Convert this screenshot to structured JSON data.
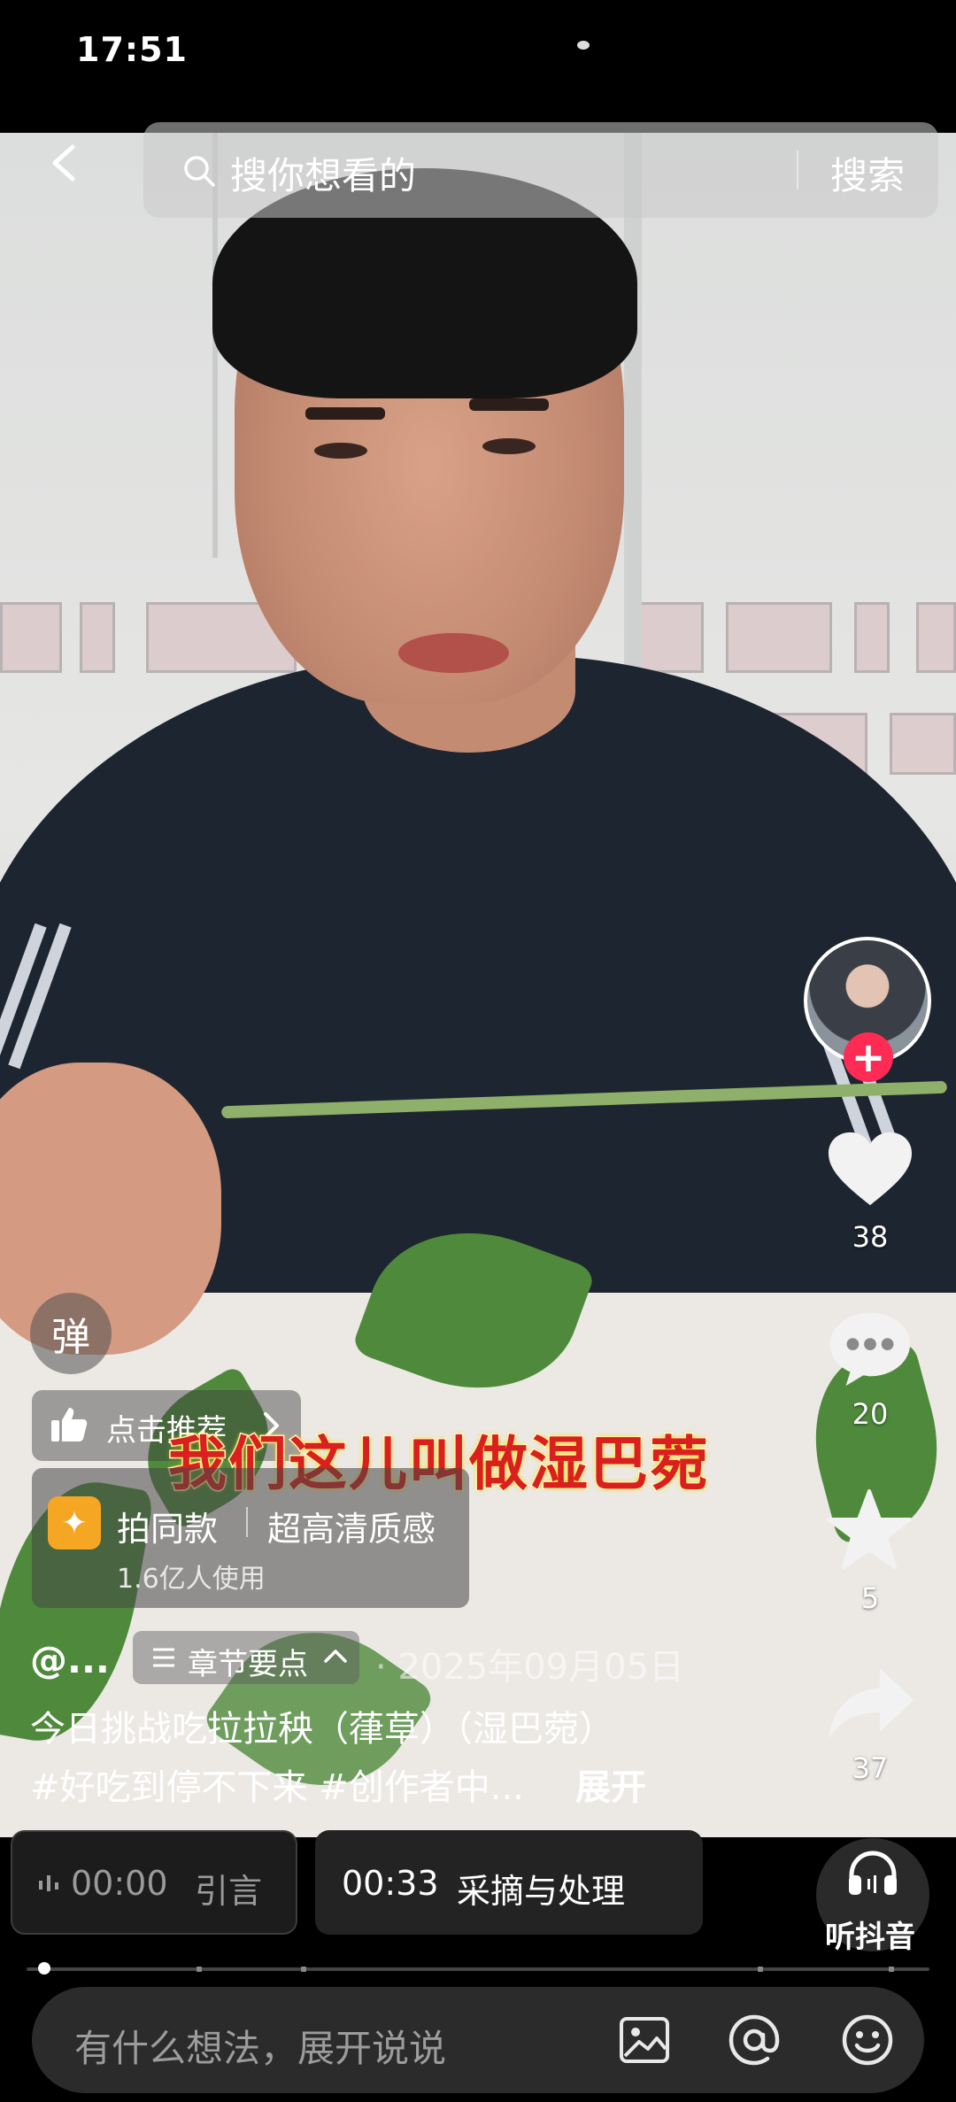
{
  "status_bar": {
    "time": "17:51"
  },
  "top_bar": {
    "search_placeholder": "搜你想看的",
    "search_button": "搜索"
  },
  "right_rail": {
    "follow_symbol": "+",
    "likes": "38",
    "comments": "20",
    "favorites": "5",
    "shares": "37"
  },
  "danmaku": {
    "label": "弹"
  },
  "recommend": {
    "label": "点击推荐"
  },
  "video_caption": "我们这儿叫做湿巴菀",
  "same_style_card": {
    "title": "拍同款",
    "subtitle": "超高清质感",
    "users": "1.6亿人使用"
  },
  "post": {
    "author": "@...",
    "chapter_button": "章节要点",
    "date": "· 2025年09月05日",
    "title": "今日挑战吃拉拉秧（葎草）（湿巴菀）",
    "tags": "#好吃到停不下来 #创作者中...",
    "expand": "展开"
  },
  "chapters": [
    {
      "time": "00:00",
      "name": "引言"
    },
    {
      "time": "00:33",
      "name": "采摘与处理"
    }
  ],
  "listen": {
    "label": "听抖音"
  },
  "playback": {
    "progress_fraction": 0.02
  },
  "comment_bar": {
    "placeholder": "有什么想法，展开说说"
  },
  "colors": {
    "accent": "#fe2c55",
    "caption_red": "#d91f1f",
    "badge_orange": "#f5a623"
  }
}
